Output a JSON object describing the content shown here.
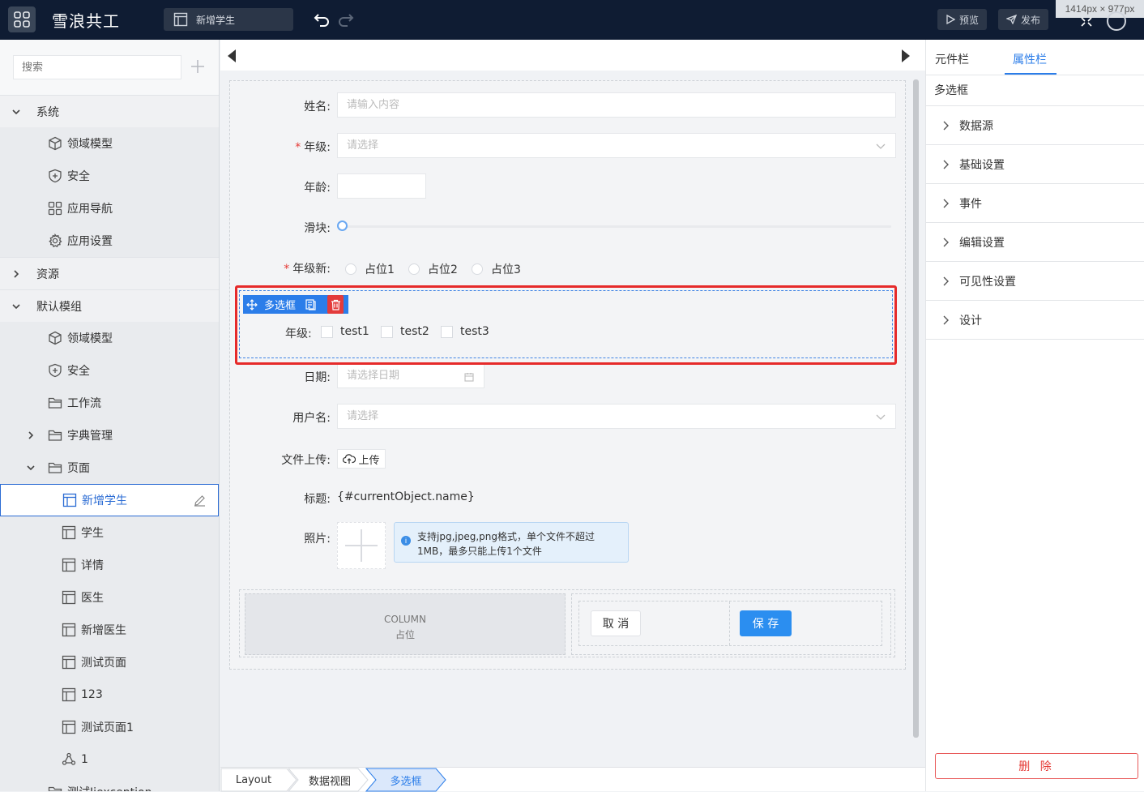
{
  "topbar": {
    "brand": "雪浪共工",
    "page_tab": "新增学生",
    "preview_label": "预览",
    "publish_label": "发布",
    "size_badge": "1414px × 977px"
  },
  "sidebar": {
    "search_placeholder": "搜索",
    "groups": [
      {
        "label": "系统",
        "items": [
          "领域模型",
          "安全",
          "应用导航",
          "应用设置"
        ]
      },
      {
        "label": "资源"
      },
      {
        "label": "默认模组",
        "items": [
          "领域模型",
          "安全",
          "工作流",
          "字典管理",
          "页面"
        ]
      }
    ],
    "pages": [
      "新增学生",
      "学生",
      "详情",
      "医生",
      "新增医生",
      "测试页面",
      "123",
      "测试页面1",
      "1",
      "测试Jiexception"
    ]
  },
  "form": {
    "name": {
      "label": "姓名:",
      "placeholder": "请输入内容"
    },
    "grade": {
      "label": "年级:",
      "placeholder": "请选择"
    },
    "age": {
      "label": "年龄:"
    },
    "slider": {
      "label": "滑块:",
      "value": 0
    },
    "grade_new": {
      "label": "年级新:",
      "options": [
        "占位1",
        "占位2",
        "占位3"
      ]
    },
    "checkbox_widget": {
      "toolbar_label": "多选框",
      "label": "年级:",
      "options": [
        "test1",
        "test2",
        "test3"
      ]
    },
    "date": {
      "label": "日期:",
      "placeholder": "请选择日期"
    },
    "username": {
      "label": "用户名:",
      "placeholder": "请选择"
    },
    "upload": {
      "label": "文件上传:",
      "button": "上传"
    },
    "title": {
      "label": "标题:",
      "value": "{#currentObject.name}"
    },
    "photo": {
      "label": "照片:",
      "hint": "支持jpg,jpeg,png格式，单个文件不超过1MB，最多只能上传1个文件"
    },
    "column": {
      "title": "COLUMN",
      "subtitle": "占位"
    },
    "cancel": "取 消",
    "save": "保 存"
  },
  "breadcrumb": [
    "Layout",
    "数据视图",
    "多选框"
  ],
  "right_panel": {
    "tabs": [
      "元件栏",
      "属性栏"
    ],
    "active_tab": "属性栏",
    "component_name": "多选框",
    "sections": [
      "数据源",
      "基础设置",
      "事件",
      "编辑设置",
      "可见性设置",
      "设计"
    ],
    "delete_label": "删 除"
  },
  "colors": {
    "topbar": "#0f1c33",
    "accent": "#2b7de9",
    "selection": "#e62a2a",
    "danger": "#e53935"
  }
}
